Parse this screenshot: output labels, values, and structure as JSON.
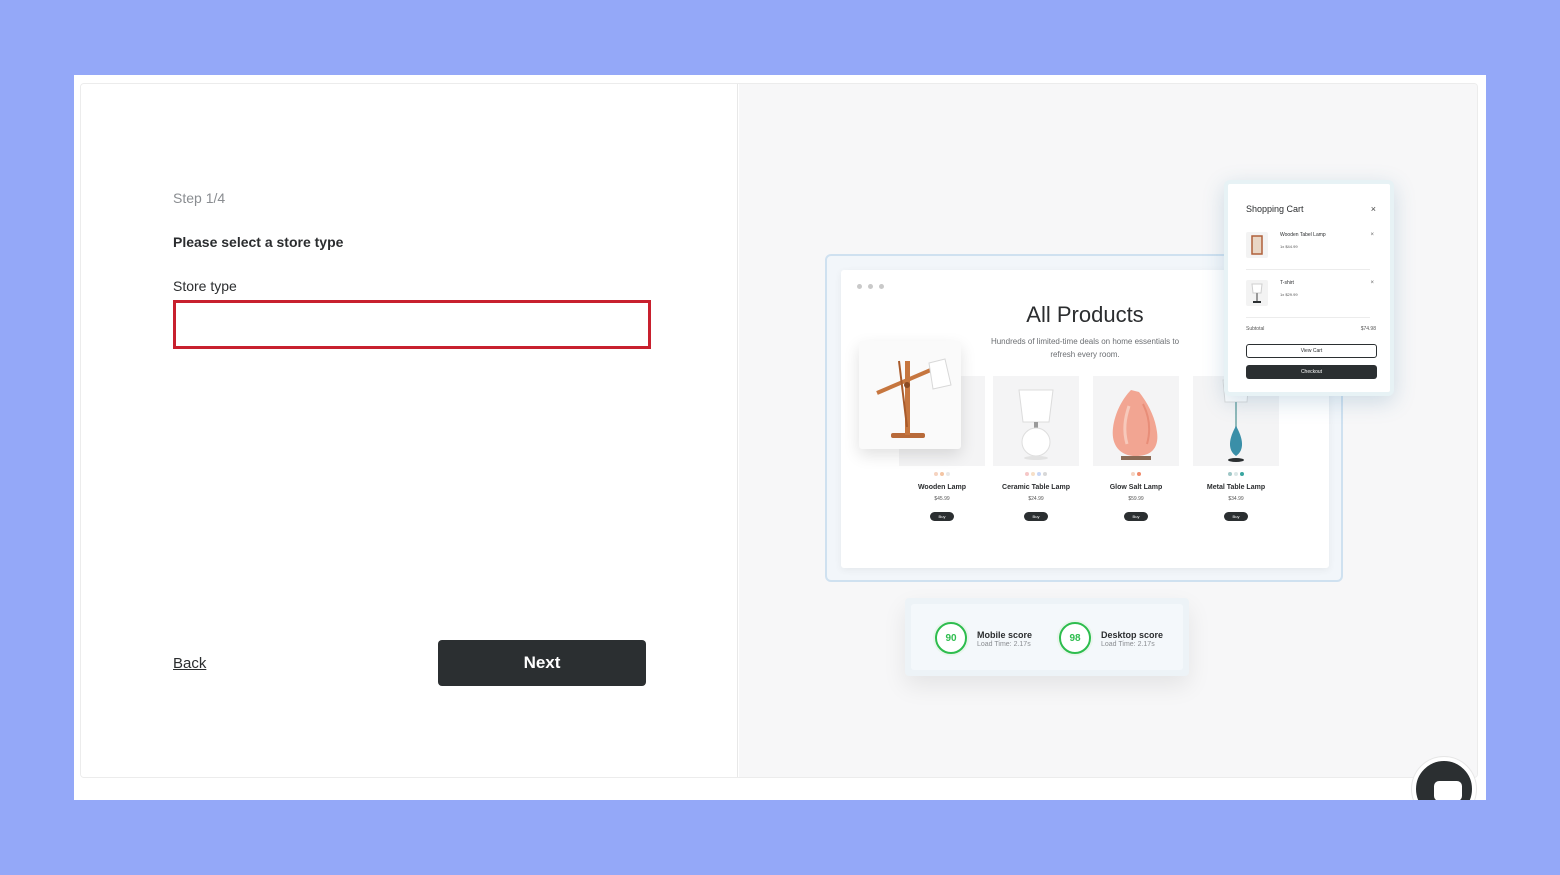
{
  "wizard": {
    "step": "Step 1/4",
    "heading": "Please select a store type",
    "field_label": "Store type",
    "field_value": "",
    "back_label": "Back",
    "next_label": "Next"
  },
  "preview": {
    "title": "All Products",
    "subtitle": "Hundreds of limited-time deals on home essentials to refresh every room.",
    "products": [
      {
        "name": "Wooden Lamp",
        "price": "$45.99",
        "buy": "Buy",
        "swatches": [
          "#f6d3c0",
          "#f4c5a4",
          "#e8e8e8"
        ]
      },
      {
        "name": "Ceramic Table Lamp",
        "price": "$24.99",
        "buy": "Buy",
        "swatches": [
          "#f6c7c7",
          "#f6dfc7",
          "#c7d6f6",
          "#d8d8d8"
        ]
      },
      {
        "name": "Glow Salt Lamp",
        "price": "$59.99",
        "buy": "Buy",
        "swatches": [
          "#f6d3c0",
          "#f08a6a"
        ]
      },
      {
        "name": "Metal Table Lamp",
        "price": "$34.99",
        "buy": "Buy",
        "swatches": [
          "#9fc7c7",
          "#d9e6e6",
          "#3aa6a0"
        ]
      }
    ],
    "cart": {
      "title": "Shopping Cart",
      "close": "×",
      "items": [
        {
          "name": "Wooden Tabel Lamp",
          "qty_price": "1x $44.99",
          "remove": "×"
        },
        {
          "name": "T-shirt",
          "qty_price": "1x $29.99",
          "remove": "×"
        }
      ],
      "subtotal_label": "Subtotal",
      "subtotal_value": "$74.98",
      "view_cart": "View Cart",
      "checkout": "Checkout"
    },
    "scores": [
      {
        "value": "90",
        "name": "Mobile score",
        "time": "Load Time: 2.17s"
      },
      {
        "value": "98",
        "name": "Desktop score",
        "time": "Load Time: 2.17s"
      }
    ]
  },
  "colors": {
    "background": "#94a8f8",
    "error_border": "#c8202e",
    "primary_button": "#2b2f31",
    "score_green": "#2ebd4e"
  },
  "icons": {
    "chat": "chat-bubble-icon"
  }
}
